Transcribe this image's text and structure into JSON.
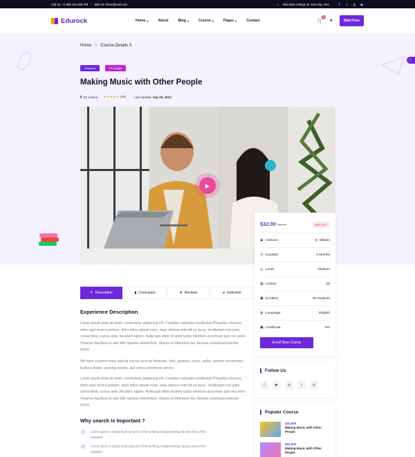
{
  "topbar": {
    "call": "Call Us: +1 800 123 458 769",
    "mail": "Mail Us: ltcroc@mail.com",
    "address": "684 West College St. Sun City, USA",
    "social": [
      "facebook-icon",
      "twitter-icon",
      "instagram-icon",
      "youtube-icon"
    ]
  },
  "header": {
    "logo": "Edurock",
    "nav": [
      {
        "label": "Home",
        "dropdown": true
      },
      {
        "label": "About",
        "dropdown": false
      },
      {
        "label": "Blog",
        "dropdown": true
      },
      {
        "label": "Course",
        "dropdown": true
      },
      {
        "label": "Pages",
        "dropdown": true
      },
      {
        "label": "Contact",
        "dropdown": false
      }
    ],
    "cart_count": "0",
    "cta": "Start Free"
  },
  "breadcrumb": {
    "home": "Home",
    "sep": "›",
    "current": "Course-Details 3"
  },
  "badges": [
    "Featured",
    "Ux Design"
  ],
  "course": {
    "title": "Making Music with Other People",
    "lessons": "23 Lesson",
    "stars": "★★★★★",
    "reviews": "(44)",
    "update_label": "Last Update:",
    "update_date": "Sep 29, 2023"
  },
  "card": {
    "price": "$32.00",
    "old_price": "/$67.00",
    "discount": "68% OFF",
    "rows": [
      {
        "icon": "instructor-icon",
        "label": "Instrutor:",
        "value": "D. Willaim"
      },
      {
        "icon": "clock-icon",
        "label": "Duration:",
        "value": "3 Months"
      },
      {
        "icon": "level-icon",
        "label": "Level:",
        "value": "Medium"
      },
      {
        "icon": "lesson-icon",
        "label": "Lesson:",
        "value": "08"
      },
      {
        "icon": "enrolled-icon",
        "label": "Enrolled:",
        "value": "65 students"
      },
      {
        "icon": "globe-icon",
        "label": "Language:",
        "value": "English"
      },
      {
        "icon": "certificate-icon",
        "label": "Certificate:",
        "value": "Yes"
      }
    ],
    "enroll": "Enroll Now Course"
  },
  "tabs": [
    {
      "icon": "description-icon",
      "label": "Description",
      "active": true
    },
    {
      "icon": "book-icon",
      "label": "Curriculum",
      "active": false
    },
    {
      "icon": "star-icon",
      "label": "Reviews",
      "active": false
    },
    {
      "icon": "user-icon",
      "label": "Instructor",
      "active": false
    }
  ],
  "description": {
    "heading": "Experience Description",
    "p1": "Lorem ipsum dolor sit amet, consectetur adipiscing elit. Curabitur vulputate vestibulum Phasellus rhoncus, dolor eget viverra pretium, dolor tellus aliquet nunc, vitae ultricies erat elit eu lacus. Vestibulum non justo consectetur, cursus ante, tincidunt sapien. Nulla quis diam sit amet turpis interdum accumsan quis nec enim. Vivamus faucibus ex sed nibh egestas elementum. Mauris et bibendum dui. Aenean consequat pulvinar luctus",
    "p2": "We have covered many special events such as fireworks, fairs, parades, races, walks, awards ceremonies, fashion shows, sporting events, and even a memorial service.",
    "p3": "Lorem ipsum dolor sit amet, consectetur adipiscing elit. Curabitur vulputate vestibulum Phasellus rhoncus, dolor eget viverra pretium, dolor tellus aliquet nunc, vitae ultricies erat elit eu lacus. Vestibulum non justo consectetur, cursus ante, tincidunt sapien. Nulla quis diam sit amet turpis interdum accumsan quis nec enim. Vivamus faucibus ex sed nibh egestas elementum. Mauris et bibendum dui. Aenean consequat pulvinar luctus.",
    "why_heading": "Why search Is Important ?",
    "points": [
      "Lorem Ipsum is simply dummying text of the printing andtypesetting industry most of the standard.",
      "Lorem Ipsum is simply dummying text of the printing andtypesetting industry most of the standard."
    ]
  },
  "follow": {
    "title": "Follow Us",
    "icons": [
      "facebook-icon",
      "youtube-icon",
      "instagram-icon",
      "twitter-icon",
      "instagram-icon"
    ]
  },
  "popular": {
    "title": "Populer Course",
    "items": [
      {
        "price": "$32,000",
        "name": "Making Music with Other People"
      },
      {
        "price": "$32,000",
        "name": "Making Music with Other People"
      }
    ]
  }
}
